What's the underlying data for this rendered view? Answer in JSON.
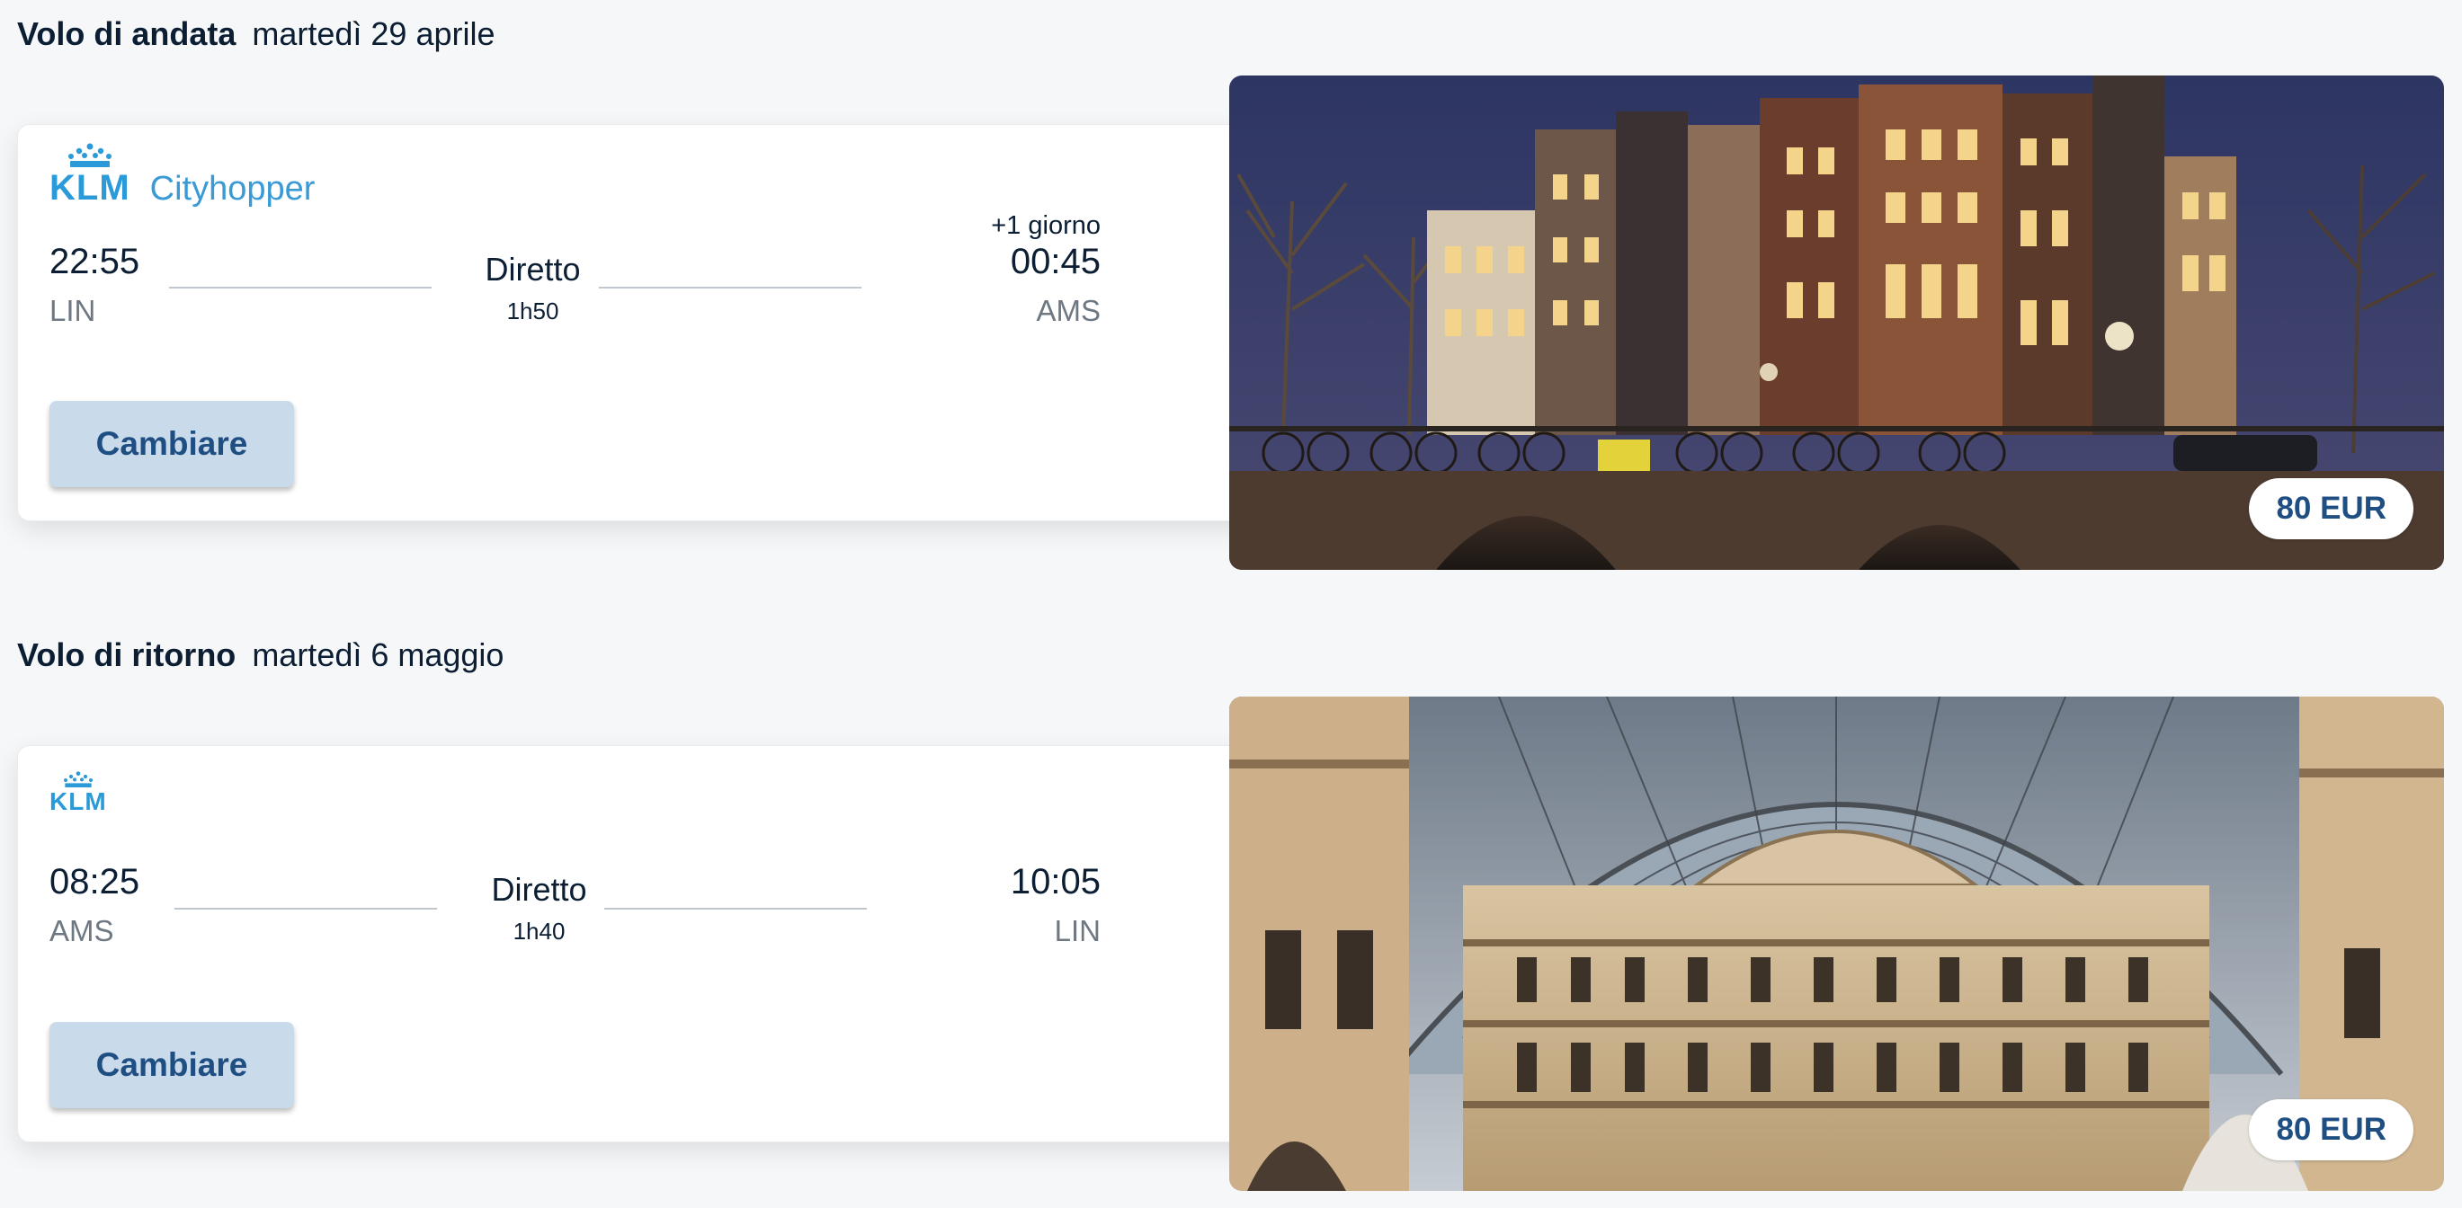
{
  "outbound": {
    "label": "Volo di andata",
    "date": "martedì 29 aprile",
    "airline": {
      "logo_text": "KLM",
      "brand": "Cityhopper",
      "icon": "klm-crown-icon"
    },
    "departure_time": "22:55",
    "departure_code": "LIN",
    "stops": "Diretto",
    "duration": "1h50",
    "arrival_day_offset": "+1 giorno",
    "arrival_time": "00:45",
    "arrival_code": "AMS",
    "change_label": "Cambiare",
    "price": "80 EUR",
    "image": "amsterdam-canal-night-photo"
  },
  "return": {
    "label": "Volo di ritorno",
    "date": "martedì 6 maggio",
    "airline": {
      "logo_text": "KLM",
      "icon": "klm-crown-icon"
    },
    "departure_time": "08:25",
    "departure_code": "AMS",
    "stops": "Diretto",
    "duration": "1h40",
    "arrival_time": "10:05",
    "arrival_code": "LIN",
    "change_label": "Cambiare",
    "price": "80 EUR",
    "image": "milan-galleria-photo"
  },
  "colors": {
    "brand_blue": "#2b9ad8",
    "button_bg": "#c9dbea",
    "button_text": "#1f4f82",
    "text": "#0b1e33"
  }
}
